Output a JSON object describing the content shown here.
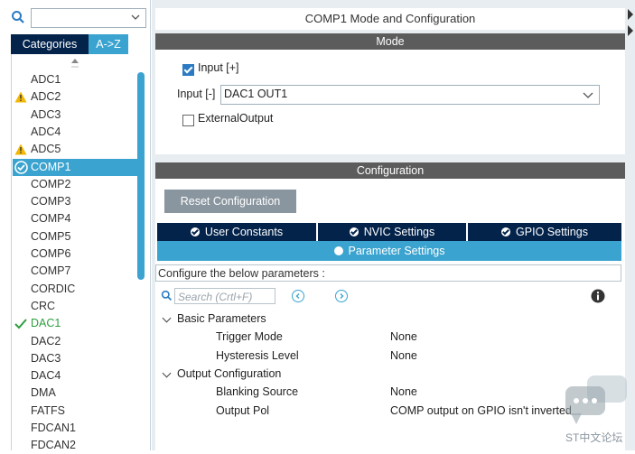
{
  "sidebar": {
    "search": {
      "value": "",
      "placeholder": ""
    },
    "tabs": {
      "categories": "Categories",
      "az": "A->Z"
    },
    "items": [
      {
        "label": "ADC1",
        "status": "none"
      },
      {
        "label": "ADC2",
        "status": "warning"
      },
      {
        "label": "ADC3",
        "status": "none"
      },
      {
        "label": "ADC4",
        "status": "none"
      },
      {
        "label": "ADC5",
        "status": "warning"
      },
      {
        "label": "COMP1",
        "status": "selected"
      },
      {
        "label": "COMP2",
        "status": "none"
      },
      {
        "label": "COMP3",
        "status": "none"
      },
      {
        "label": "COMP4",
        "status": "none"
      },
      {
        "label": "COMP5",
        "status": "none"
      },
      {
        "label": "COMP6",
        "status": "none"
      },
      {
        "label": "COMP7",
        "status": "none"
      },
      {
        "label": "CORDIC",
        "status": "none"
      },
      {
        "label": "CRC",
        "status": "none"
      },
      {
        "label": "DAC1",
        "status": "configured"
      },
      {
        "label": "DAC2",
        "status": "none"
      },
      {
        "label": "DAC3",
        "status": "none"
      },
      {
        "label": "DAC4",
        "status": "none"
      },
      {
        "label": "DMA",
        "status": "none"
      },
      {
        "label": "FATFS",
        "status": "none"
      },
      {
        "label": "FDCAN1",
        "status": "none"
      },
      {
        "label": "FDCAN2",
        "status": "none"
      }
    ]
  },
  "main": {
    "title": "COMP1 Mode and Configuration",
    "mode": {
      "header": "Mode",
      "input_plus_label": "Input [+]",
      "input_plus_checked": true,
      "input_minus_label": "Input [-]",
      "input_minus_value": "DAC1 OUT1",
      "external_output_label": "ExternalOutput",
      "external_output_checked": false
    },
    "configuration": {
      "header": "Configuration",
      "reset_button": "Reset Configuration",
      "tabs": {
        "user_constants": "User Constants",
        "nvic": "NVIC Settings",
        "gpio": "GPIO Settings",
        "parameters": "Parameter Settings"
      },
      "configure_text": "Configure the below parameters :",
      "search_placeholder": "Search (Crtl+F)",
      "groups": [
        {
          "name": "Basic Parameters",
          "params": [
            {
              "name": "Trigger Mode",
              "value": "None"
            },
            {
              "name": "Hysteresis Level",
              "value": "None"
            }
          ]
        },
        {
          "name": "Output Configuration",
          "params": [
            {
              "name": "Blanking Source",
              "value": "None"
            },
            {
              "name": "Output Pol",
              "value": "COMP output on GPIO isn't inverted"
            }
          ]
        }
      ]
    }
  },
  "watermark": {
    "text": "ST中文论坛"
  },
  "colors": {
    "navy": "#03234b",
    "accent": "#3aa3cf",
    "header_gray": "#5c5c5c",
    "warning": "#f2b705",
    "green": "#2e9e3e"
  }
}
